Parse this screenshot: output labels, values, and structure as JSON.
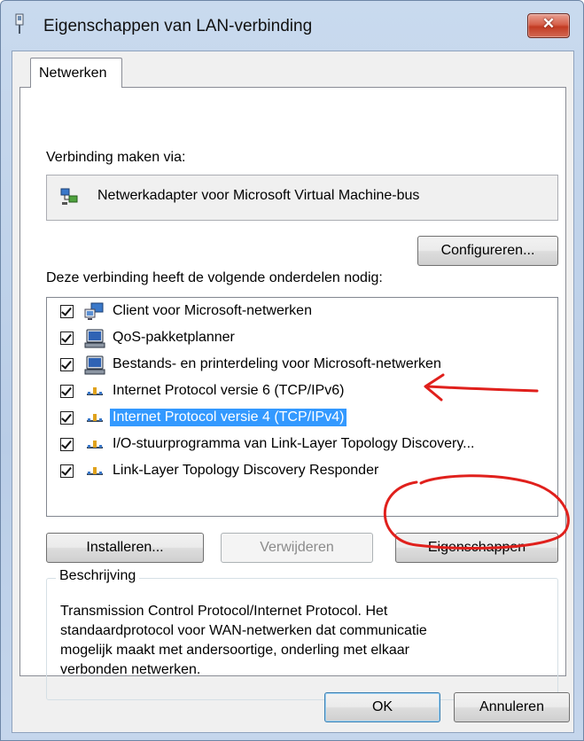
{
  "window": {
    "title": "Eigenschappen van LAN-verbinding",
    "close_glyph": "✕",
    "accent": "#3399ff",
    "close_color": "#c23b23"
  },
  "tabs": [
    {
      "label": "Netwerken",
      "selected": true
    }
  ],
  "connect_via": {
    "label": "Verbinding maken via:",
    "adapter_name": "Netwerkadapter voor Microsoft Virtual Machine-bus",
    "adapter_icon": "network-adapter-icon",
    "configure_button": "Configureren..."
  },
  "components": {
    "label": "Deze verbinding heeft de volgende onderdelen nodig:",
    "items": [
      {
        "label": "Client voor Microsoft-netwerken",
        "checked": true,
        "icon": "client-network-icon",
        "selected": false
      },
      {
        "label": "QoS-pakketplanner",
        "checked": true,
        "icon": "computer-service-icon",
        "selected": false
      },
      {
        "label": "Bestands- en printerdeling voor Microsoft-netwerken",
        "checked": true,
        "icon": "computer-service-icon",
        "selected": false
      },
      {
        "label": "Internet Protocol versie 6 (TCP/IPv6)",
        "checked": true,
        "icon": "protocol-icon",
        "selected": false
      },
      {
        "label": "Internet Protocol versie 4 (TCP/IPv4)",
        "checked": true,
        "icon": "protocol-icon",
        "selected": true
      },
      {
        "label": "I/O-stuurprogramma van Link-Layer Topology Discovery...",
        "checked": true,
        "icon": "protocol-icon",
        "selected": false
      },
      {
        "label": "Link-Layer Topology Discovery Responder",
        "checked": true,
        "icon": "protocol-icon",
        "selected": false
      }
    ]
  },
  "actions": {
    "install": "Installeren...",
    "remove": "Verwijderen",
    "remove_enabled": false,
    "properties": "Eigenschappen"
  },
  "description": {
    "legend": "Beschrijving",
    "lines": [
      "Transmission Control Protocol/Internet Protocol. Het",
      "standaardprotocol voor WAN-netwerken dat communicatie",
      "mogelijk maakt met andersoortige, onderling met elkaar",
      "verbonden netwerken."
    ]
  },
  "footer": {
    "ok": "OK",
    "cancel": "Annuleren"
  },
  "annotations": {
    "color": "#e0201c",
    "arrow_target": "Internet Protocol versie 4 (TCP/IPv4)",
    "circle_target": "Eigenschappen"
  }
}
